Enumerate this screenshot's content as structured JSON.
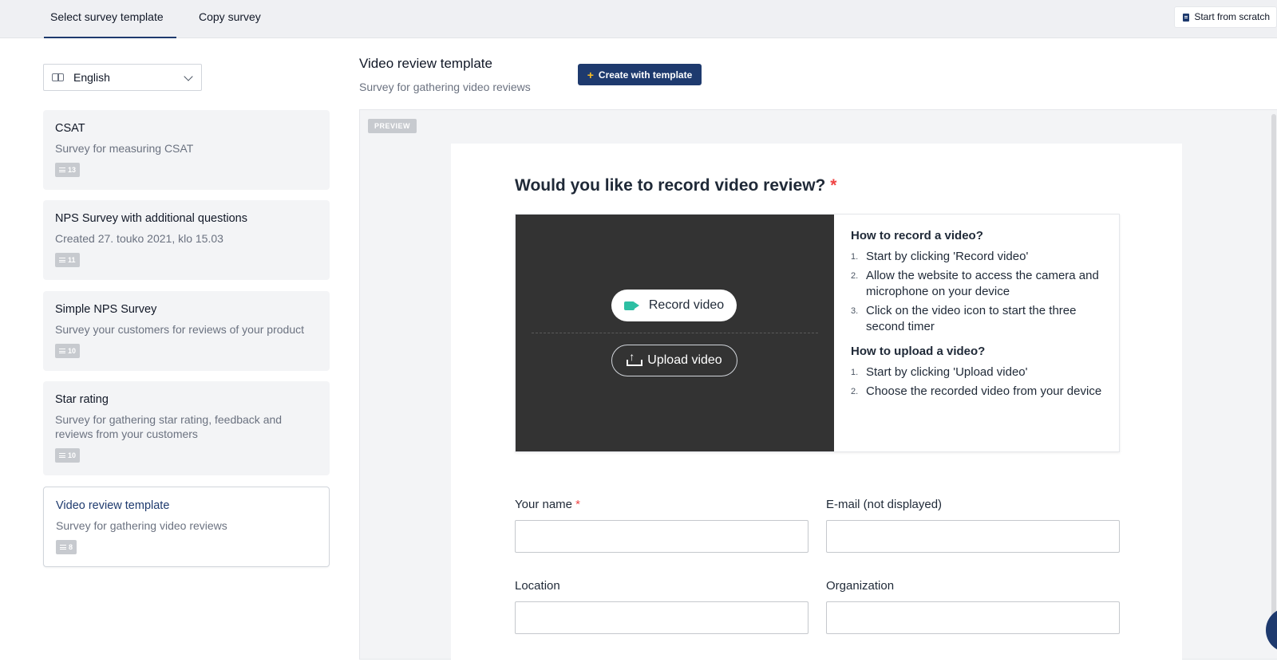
{
  "tabs": [
    {
      "label": "Select survey template",
      "active": true
    },
    {
      "label": "Copy survey",
      "active": false
    }
  ],
  "start_from_scratch": "Start from scratch",
  "language": "English",
  "templates": [
    {
      "title": "CSAT",
      "desc": "Survey for measuring CSAT",
      "count": "13"
    },
    {
      "title": "NPS Survey with additional questions",
      "desc": "Created 27. touko 2021, klo 15.03",
      "count": "11"
    },
    {
      "title": "Simple NPS Survey",
      "desc": "Survey your customers for reviews of your product",
      "count": "10"
    },
    {
      "title": "Star rating",
      "desc": "Survey for gathering star rating, feedback and reviews from your customers",
      "count": "10"
    },
    {
      "title": "Video review template",
      "desc": "Survey for gathering video reviews",
      "count": "8",
      "selected": true
    }
  ],
  "selected_template": {
    "title": "Video review template",
    "subtitle": "Survey for gathering video reviews",
    "create_label": "Create with template"
  },
  "preview": {
    "badge": "PREVIEW",
    "question": "Would you like to record video review?",
    "required_mark": "*",
    "record_label": "Record video",
    "upload_label": "Upload video",
    "record_help_title": "How to record a video?",
    "record_steps": [
      "Start by clicking 'Record video'",
      "Allow the website to access the camera and microphone on your device",
      "Click on the video icon to start the three second timer"
    ],
    "upload_help_title": "How to upload a video?",
    "upload_steps": [
      "Start by clicking 'Upload video'",
      "Choose the recorded video from your device"
    ],
    "fields": {
      "name": "Your name",
      "email": "E-mail (not displayed)",
      "location": "Location",
      "organization": "Organization"
    }
  },
  "colors": {
    "brand": "#1e3a6e",
    "accent": "#fbbf24",
    "record_icon": "#2dbfa3",
    "required": "#ef4444"
  }
}
